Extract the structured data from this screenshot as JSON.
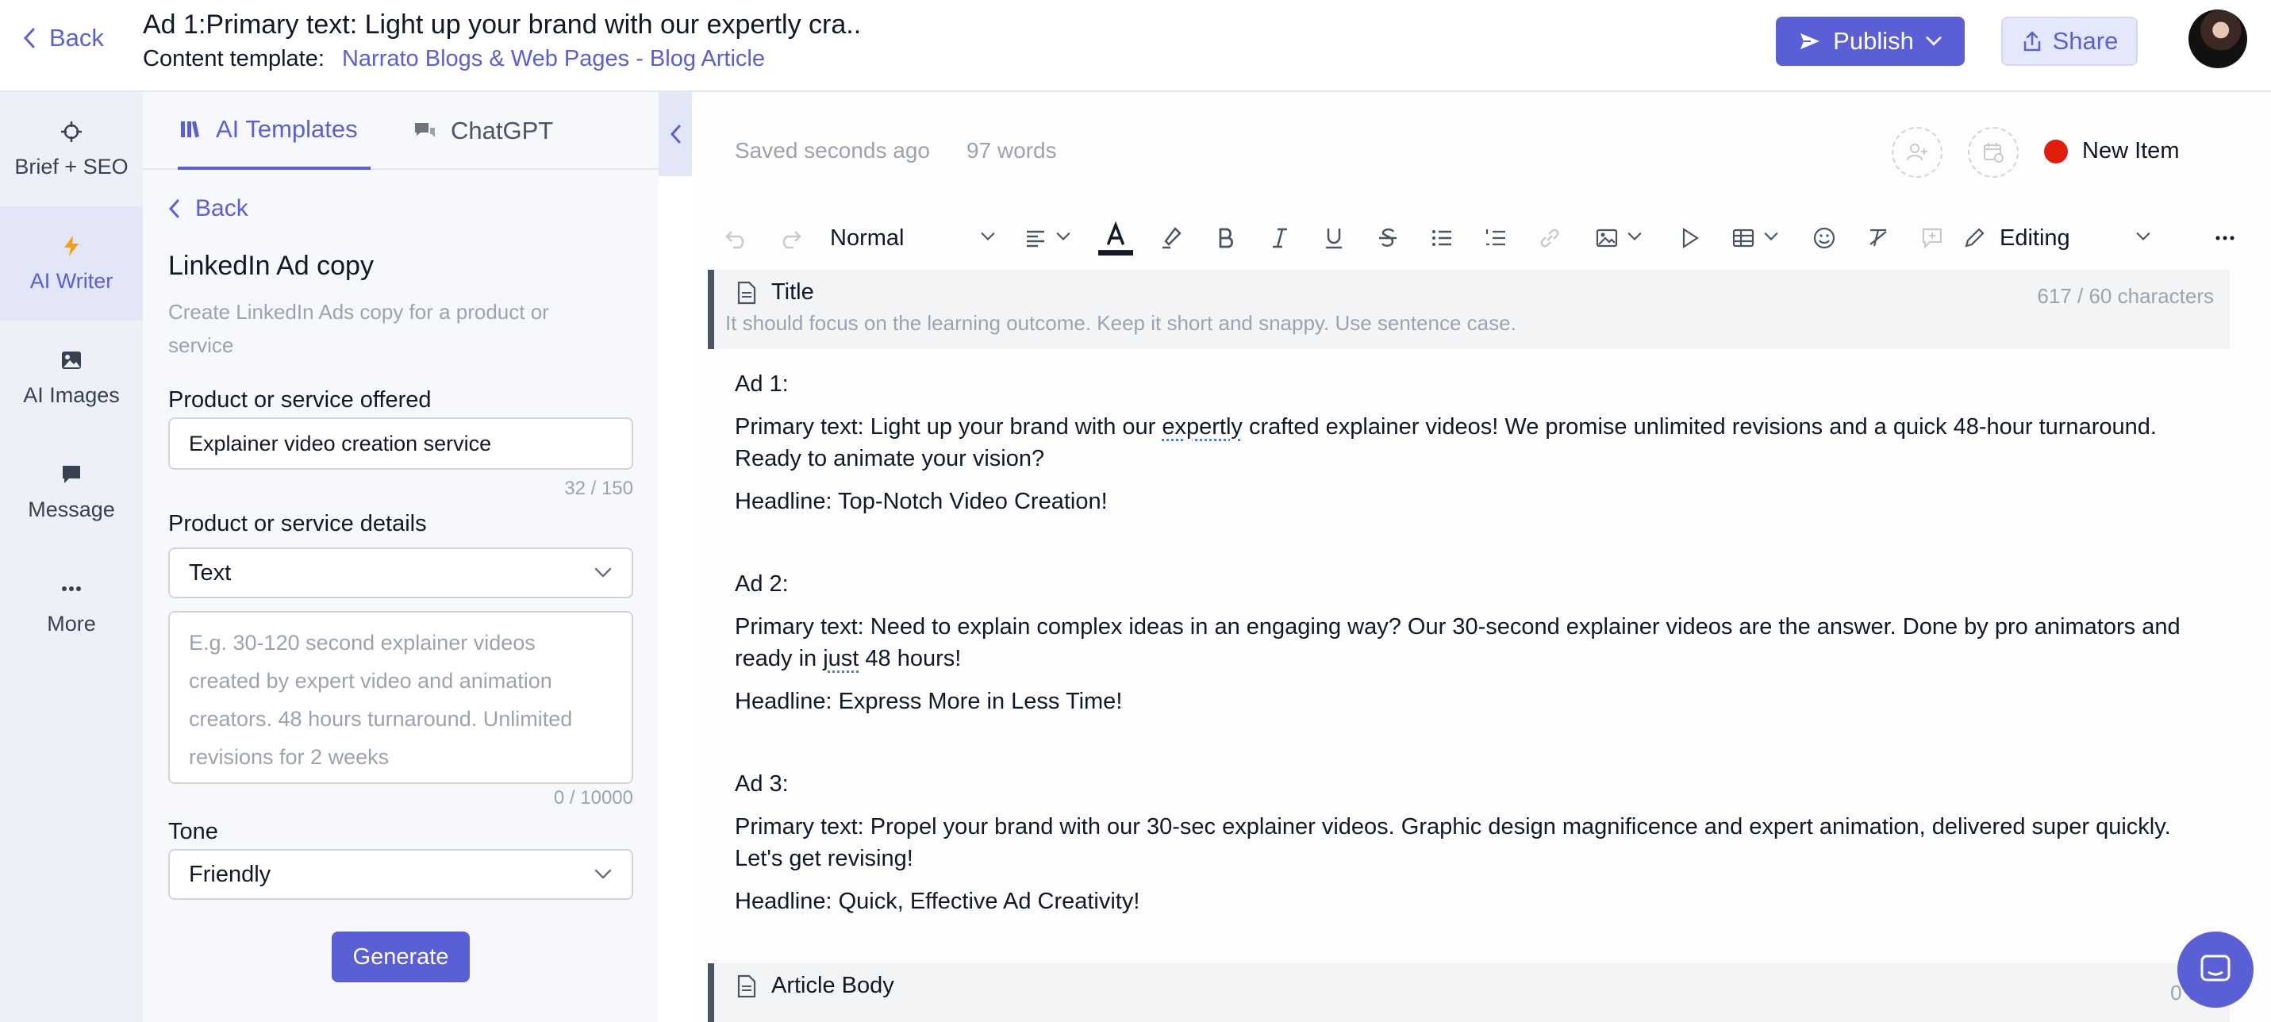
{
  "header": {
    "back_label": "Back",
    "title": "Ad 1:Primary text: Light up your brand with our expertly cra..",
    "template_label": "Content template:",
    "template_link": "Narrato Blogs & Web Pages - Blog Article",
    "publish_label": "Publish",
    "share_label": "Share"
  },
  "rail": {
    "items": [
      {
        "label": "Brief + SEO",
        "icon": "crosshair-icon"
      },
      {
        "label": "AI Writer",
        "icon": "bolt-icon"
      },
      {
        "label": "AI Images",
        "icon": "image-icon"
      },
      {
        "label": "Message",
        "icon": "message-icon"
      },
      {
        "label": "More",
        "icon": "more-dots-icon"
      }
    ]
  },
  "panel": {
    "tabs": [
      {
        "label": "AI Templates",
        "icon": "templates-icon"
      },
      {
        "label": "ChatGPT",
        "icon": "chat-icon"
      }
    ],
    "back_label": "Back",
    "title": "LinkedIn Ad copy",
    "description": "Create LinkedIn Ads copy for a product or service",
    "product_label": "Product or service offered",
    "product_value": "Explainer video creation service",
    "product_counter": "32 / 150",
    "details_label": "Product or service details",
    "details_type": "Text",
    "details_placeholder": "E.g. 30-120 second explainer videos created by expert video and animation creators. 48 hours turnaround. Unlimited revisions for 2 weeks",
    "details_counter": "0 / 10000",
    "tone_label": "Tone",
    "tone_value": "Friendly",
    "generate_label": "Generate"
  },
  "editor": {
    "saved_text": "Saved seconds ago",
    "word_count": "97 words",
    "status_label": "New Item",
    "status_color": "#e11d0b",
    "toolbar": {
      "style_value": "Normal",
      "mode_value": "Editing"
    },
    "title_field": {
      "label": "Title",
      "hint": "It should focus on the learning outcome. Keep it short and snappy. Use sentence case.",
      "counter": "617 / 60 characters"
    },
    "ads": [
      {
        "heading": "Ad 1:",
        "primary_a": "Primary text: Light up your brand with our ",
        "primary_squig": "expertly",
        "primary_b": " crafted explainer videos! We promise unlimited revisions and a quick 48-hour turnaround. Ready to animate your vision?",
        "headline": "Headline: Top-Notch Video Creation!"
      },
      {
        "heading": "Ad 2:",
        "primary_a": "Primary text: Need to explain complex ideas in an engaging way? Our 30-second explainer videos are the answer. Done by pro animators and ready in ",
        "primary_squig": "just",
        "primary_b": " 48 hours!",
        "headline": "Headline: Express More in Less Time!"
      },
      {
        "heading": "Ad 3:",
        "primary_a": "Primary text: Propel your brand with our 30-sec explainer videos. Graphic design magnificence and expert animation, delivered super quickly. Let's get revising!",
        "primary_squig": "",
        "primary_b": "",
        "headline": "Headline: Quick, Effective Ad Creativity!"
      }
    ],
    "body_field": {
      "label": "Article Body",
      "counter": "0 wo"
    }
  },
  "colors": {
    "accent": "#5b5fd6",
    "rail_bg": "#eef0f8",
    "panel_bg": "#f7f8fb"
  }
}
